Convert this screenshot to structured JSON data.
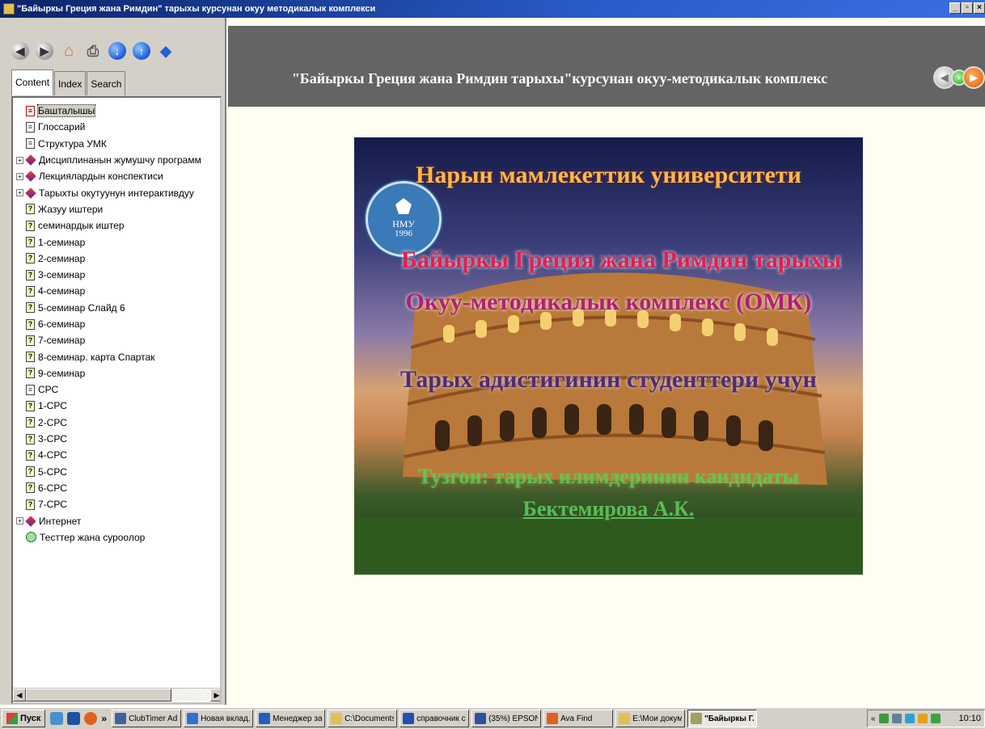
{
  "window": {
    "title": "\"Байыркы Греция жана Римдин\" тарыхы курсунан окуу методикалык комплекси"
  },
  "toolbar": {
    "icons": [
      "back-icon",
      "forward-icon",
      "home-icon",
      "print-icon",
      "down-icon",
      "up-icon",
      "options-icon"
    ]
  },
  "tabs": [
    {
      "label": "Content"
    },
    {
      "label": "Index"
    },
    {
      "label": "Search"
    }
  ],
  "tree": [
    {
      "label": "Башталышы",
      "icon": "red-page",
      "expander": false,
      "selected": true
    },
    {
      "label": "Глоссарий",
      "icon": "page",
      "expander": false
    },
    {
      "label": "Структура УМК",
      "icon": "page",
      "expander": false
    },
    {
      "label": "Дисциплинанын жумушчу программ",
      "icon": "book",
      "expander": true
    },
    {
      "label": "Лекциялардын конспектиси",
      "icon": "book",
      "expander": true
    },
    {
      "label": "Тарыхты окутуунун интерактивдуу",
      "icon": "book",
      "expander": true
    },
    {
      "label": "Жазуу иштери",
      "icon": "question",
      "expander": false
    },
    {
      "label": "семинардык иштер",
      "icon": "question",
      "expander": false
    },
    {
      "label": "1-семинар",
      "icon": "question",
      "expander": false
    },
    {
      "label": "2-семинар",
      "icon": "question",
      "expander": false
    },
    {
      "label": "3-семинар",
      "icon": "question",
      "expander": false
    },
    {
      "label": "4-семинар",
      "icon": "question",
      "expander": false
    },
    {
      "label": "5-семинар Слайд 6",
      "icon": "question",
      "expander": false
    },
    {
      "label": "6-семинар",
      "icon": "question",
      "expander": false
    },
    {
      "label": "7-семинар",
      "icon": "question",
      "expander": false
    },
    {
      "label": "8-семинар. карта Спартак",
      "icon": "question",
      "expander": false
    },
    {
      "label": "9-семинар",
      "icon": "question",
      "expander": false
    },
    {
      "label": "СРС",
      "icon": "page",
      "expander": false
    },
    {
      "label": "1-СРС",
      "icon": "question",
      "expander": false
    },
    {
      "label": "2-СРС",
      "icon": "question",
      "expander": false
    },
    {
      "label": "3-СРС",
      "icon": "question",
      "expander": false
    },
    {
      "label": "4-СРС",
      "icon": "question",
      "expander": false
    },
    {
      "label": "5-СРС",
      "icon": "question",
      "expander": false
    },
    {
      "label": "6-СРС",
      "icon": "question",
      "expander": false
    },
    {
      "label": "7-СРС",
      "icon": "question",
      "expander": false
    },
    {
      "label": "Интернет",
      "icon": "book",
      "expander": true
    },
    {
      "label": "Тесттер жана суроолор",
      "icon": "globe",
      "expander": false
    }
  ],
  "header": {
    "title": "\"Байыркы Греция жана Римдин тарыхы\"курсунан окуу-методикалык комплекс"
  },
  "hero": {
    "line1": "Нарын мамлекеттик университети",
    "line2": "Байыркы Греция жана Римдин тарыхы",
    "line3": "Окуу-методикалык комплекс (ОМК)",
    "line4": "Тарых адистигинин студенттери учун",
    "line5": "Тузгон: тарых илимдеринин кандидаты",
    "line6": "Бектемирова А.К.",
    "seal_top": "НМУ",
    "seal_year": "1996"
  },
  "taskbar": {
    "start_label": "Пуск",
    "tasks": [
      {
        "label": "ClubTimer Ad...",
        "color": "#4060a0"
      },
      {
        "label": "Новая вклад...",
        "color": "#3070d0"
      },
      {
        "label": "Менеджер за...",
        "color": "#2060c0"
      },
      {
        "label": "C:\\Documents...",
        "color": "#e0c050"
      },
      {
        "label": "справочник с ...",
        "color": "#2050b0"
      },
      {
        "label": "(35%) EPSON ...",
        "color": "#3050a0"
      },
      {
        "label": "Ava Find",
        "color": "#e06020"
      },
      {
        "label": "E:\\Мои докум...",
        "color": "#e0c050"
      },
      {
        "label": "\"Байыркы Г...",
        "color": "#a0a060",
        "active": true
      }
    ],
    "clock": "10:10"
  }
}
